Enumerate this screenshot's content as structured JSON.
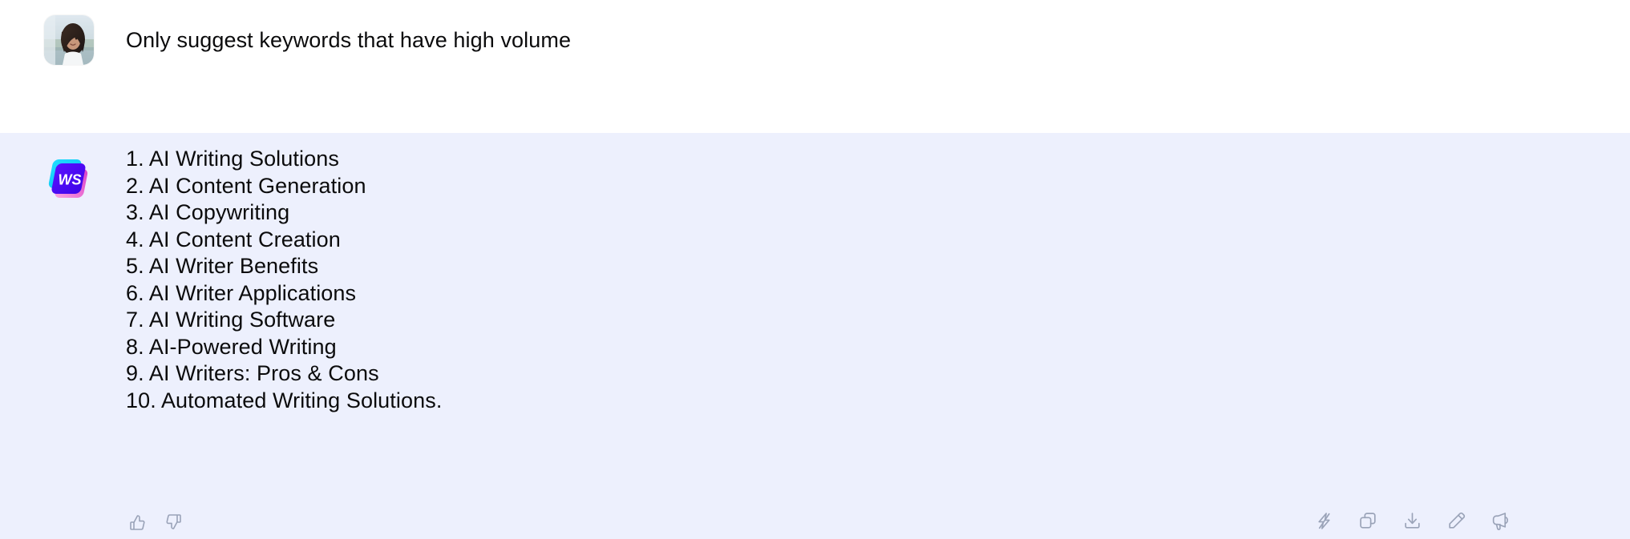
{
  "conversation": {
    "user_turn": {
      "avatar_alt": "user-avatar-photo",
      "message": "Only suggest keywords that have high volume"
    },
    "assistant_turn": {
      "logo_text": "WS",
      "logo_name": "writesonic-logo",
      "items": [
        "1. AI Writing Solutions",
        "2. AI Content Generation",
        "3. AI Copywriting",
        "4. AI Content Creation",
        "5. AI Writer Benefits",
        "6. AI Writer Applications",
        "7. AI Writing Software",
        "8. AI-Powered Writing",
        "9. AI Writers: Pros & Cons",
        "10. Automated Writing Solutions."
      ],
      "feedback": [
        {
          "name": "thumbs-up-icon",
          "label": "Good response"
        },
        {
          "name": "thumbs-down-icon",
          "label": "Bad response"
        }
      ],
      "actions": [
        {
          "name": "lightning-icon",
          "label": "Quick action"
        },
        {
          "name": "copy-icon",
          "label": "Copy"
        },
        {
          "name": "download-icon",
          "label": "Download"
        },
        {
          "name": "pencil-icon",
          "label": "Edit"
        },
        {
          "name": "megaphone-icon",
          "label": "Promote"
        }
      ]
    }
  },
  "colors": {
    "user_background": "#ffffff",
    "assistant_background": "#edf0fd",
    "text": "#0b0b0c",
    "icon": "#9aa3b8",
    "logo_cyan": "#12cdf5",
    "logo_violet": "#4a0bf5",
    "logo_pink": "#f06ed0"
  }
}
